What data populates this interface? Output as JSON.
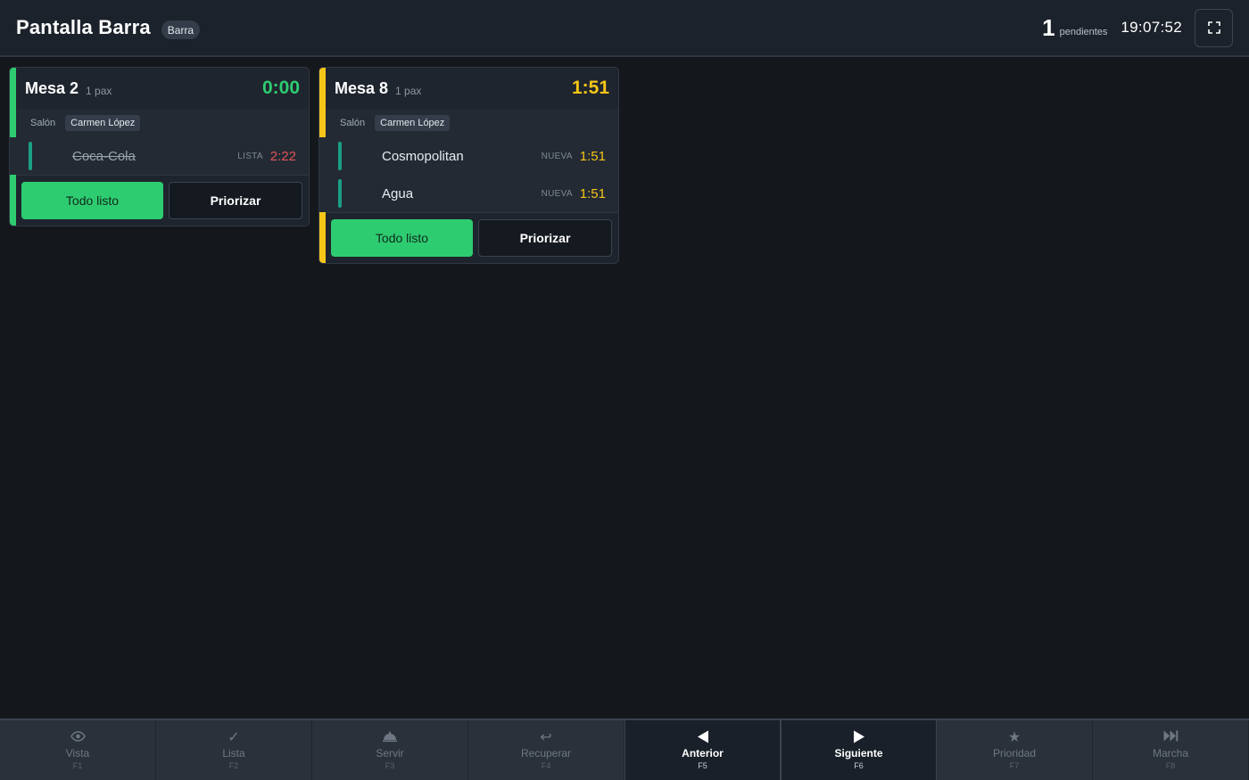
{
  "header": {
    "title": "Pantalla Barra",
    "station": "Barra",
    "pending_count": "1",
    "pending_label": "pendientes",
    "clock": "19:07:52"
  },
  "orders": [
    {
      "table": "Mesa 2",
      "pax": "1 pax",
      "timer": "0:00",
      "accent_color": "#2ecc71",
      "timer_color": "#2ecc71",
      "zone": "Salón",
      "waiter": "Carmen López",
      "items": [
        {
          "name": "Coca-Cola",
          "status": "LISTA",
          "time": "2:22",
          "time_color": "#e05555",
          "done": true
        }
      ],
      "ready_label": "Todo listo",
      "priority_label": "Priorizar"
    },
    {
      "table": "Mesa 8",
      "pax": "1 pax",
      "timer": "1:51",
      "accent_color": "#f5c518",
      "timer_color": "#f5c518",
      "zone": "Salón",
      "waiter": "Carmen López",
      "items": [
        {
          "name": "Cosmopolitan",
          "status": "NUEVA",
          "time": "1:51",
          "time_color": "#f5c518",
          "done": false
        },
        {
          "name": "Agua",
          "status": "NUEVA",
          "time": "1:51",
          "time_color": "#f5c518",
          "done": false
        }
      ],
      "ready_label": "Todo listo",
      "priority_label": "Priorizar"
    }
  ],
  "function_keys": [
    {
      "label": "Vista",
      "key": "F1",
      "icon": "eye-icon",
      "active": false
    },
    {
      "label": "Lista",
      "key": "F2",
      "icon": "check-icon",
      "active": false
    },
    {
      "label": "Servir",
      "key": "F3",
      "icon": "dish-icon",
      "active": false
    },
    {
      "label": "Recuperar",
      "key": "F4",
      "icon": "undo-icon",
      "active": false
    },
    {
      "label": "Anterior",
      "key": "F5",
      "icon": "triangle-left-icon",
      "active": true
    },
    {
      "label": "Siguiente",
      "key": "F6",
      "icon": "triangle-right-icon",
      "active": true
    },
    {
      "label": "Prioridad",
      "key": "F7",
      "icon": "star-icon",
      "active": false
    },
    {
      "label": "Marcha",
      "key": "F8",
      "icon": "skip-forward-icon",
      "active": false
    }
  ]
}
